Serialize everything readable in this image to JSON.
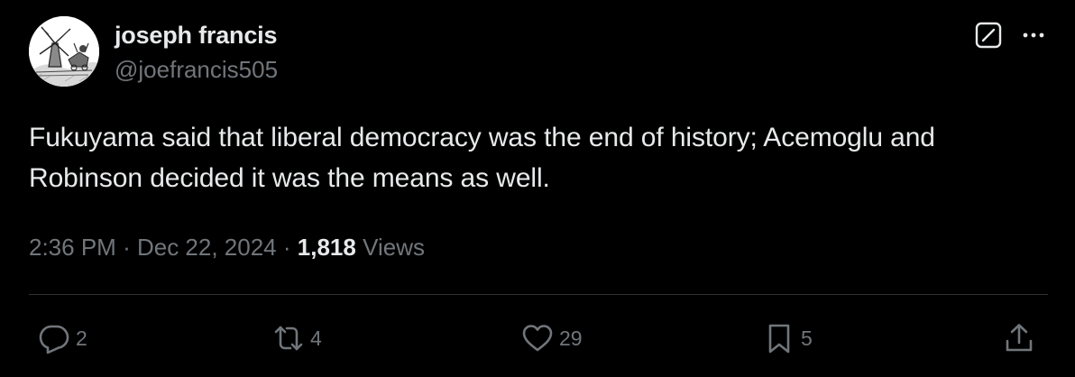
{
  "author": {
    "display_name": "joseph francis",
    "handle": "@joefrancis505"
  },
  "tweet": {
    "text": "Fukuyama said that liberal democracy was the end of history; Acemoglu and Robinson decided it was the means as well."
  },
  "meta": {
    "time": "2:36 PM",
    "separator": "·",
    "date": "Dec 22, 2024",
    "views_count": "1,818",
    "views_label": "Views"
  },
  "actions": {
    "replies": "2",
    "reposts": "4",
    "likes": "29",
    "bookmarks": "5"
  },
  "icons": {
    "avatar": "windmill-sketch-avatar",
    "grok": "grok-icon",
    "more": "more-icon",
    "reply": "reply-icon",
    "repost": "repost-icon",
    "like": "heart-icon",
    "bookmark": "bookmark-icon",
    "share": "share-icon"
  },
  "colors": {
    "background": "#000000",
    "primary_text": "#e7e9ea",
    "secondary_text": "#71767b",
    "divider": "#2f3336"
  }
}
